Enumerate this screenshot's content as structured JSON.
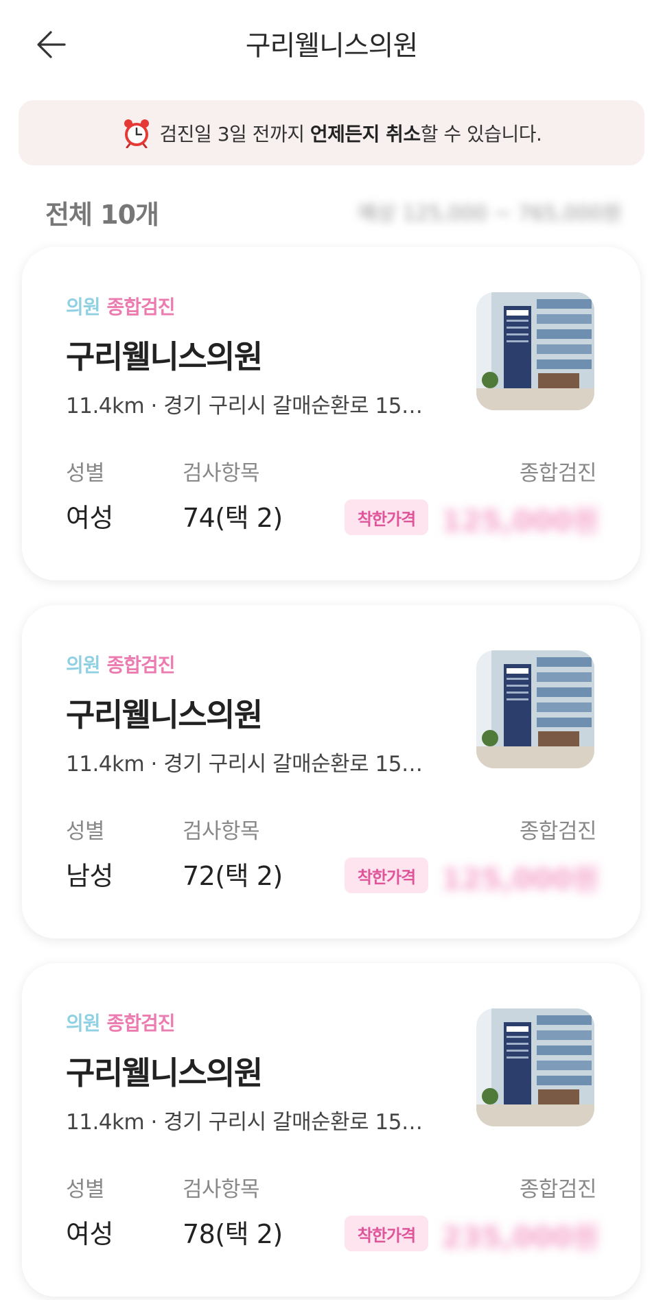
{
  "header": {
    "back_icon": "arrow-left-icon",
    "title": "구리웰니스의원"
  },
  "notice": {
    "icon": "alarm-clock-icon",
    "prefix": "검진일 3일 전까지 ",
    "bold1": "언제든지 취소",
    "suffix": "할 수 있습니다."
  },
  "summary": {
    "count": "전체 10개",
    "price_range": "예상 125,000 ~ 765,000원"
  },
  "cards": [
    {
      "tag_clinic": "의원",
      "tag_exam": "종합검진",
      "name": "구리웰니스의원",
      "address": "11.4km · 경기 구리시 갈매순환로 15…",
      "label_gender": "성별",
      "label_items": "검사항목",
      "label_type": "종합검진",
      "gender": "여성",
      "items": "74(택 2)",
      "badge": "착한가격",
      "price": "125,000원"
    },
    {
      "tag_clinic": "의원",
      "tag_exam": "종합검진",
      "name": "구리웰니스의원",
      "address": "11.4km · 경기 구리시 갈매순환로 15…",
      "label_gender": "성별",
      "label_items": "검사항목",
      "label_type": "종합검진",
      "gender": "남성",
      "items": "72(택 2)",
      "badge": "착한가격",
      "price": "125,000원"
    },
    {
      "tag_clinic": "의원",
      "tag_exam": "종합검진",
      "name": "구리웰니스의원",
      "address": "11.4km · 경기 구리시 갈매순환로 15…",
      "label_gender": "성별",
      "label_items": "검사항목",
      "label_type": "종합검진",
      "gender": "여성",
      "items": "78(택 2)",
      "badge": "착한가격",
      "price": "235,000원"
    }
  ],
  "colors": {
    "notice_bg": "#f8efef",
    "tag_clinic": "#8fd0e3",
    "tag_exam": "#ec7bb0",
    "badge_bg": "#fde4ef",
    "badge_text": "#e0559a"
  }
}
